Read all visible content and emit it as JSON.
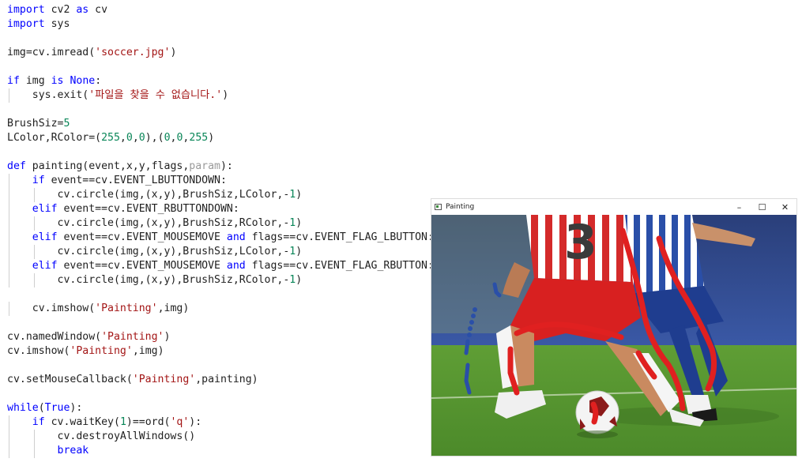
{
  "editor": {
    "lines": [
      [
        {
          "t": "import",
          "c": "kw"
        },
        {
          "t": " cv2 "
        },
        {
          "t": "as",
          "c": "kw"
        },
        {
          "t": " cv"
        }
      ],
      [
        {
          "t": "import",
          "c": "kw"
        },
        {
          "t": " sys"
        }
      ],
      [],
      [
        {
          "t": "img=cv.imread("
        },
        {
          "t": "'soccer.jpg'",
          "c": "str"
        },
        {
          "t": ")"
        }
      ],
      [],
      [
        {
          "t": "if",
          "c": "kw"
        },
        {
          "t": " img "
        },
        {
          "t": "is",
          "c": "kw"
        },
        {
          "t": " "
        },
        {
          "t": "None",
          "c": "kw"
        },
        {
          "t": ":"
        }
      ],
      [
        {
          "t": "    sys.exit("
        },
        {
          "t": "'파일을 찾을 수 없습니다.'",
          "c": "str"
        },
        {
          "t": ")"
        }
      ],
      [],
      [
        {
          "t": "BrushSiz="
        },
        {
          "t": "5",
          "c": "num"
        }
      ],
      [
        {
          "t": "LColor,RColor=("
        },
        {
          "t": "255",
          "c": "num"
        },
        {
          "t": ","
        },
        {
          "t": "0",
          "c": "num"
        },
        {
          "t": ","
        },
        {
          "t": "0",
          "c": "num"
        },
        {
          "t": "),("
        },
        {
          "t": "0",
          "c": "num"
        },
        {
          "t": ","
        },
        {
          "t": "0",
          "c": "num"
        },
        {
          "t": ","
        },
        {
          "t": "255",
          "c": "num"
        },
        {
          "t": ")"
        }
      ],
      [],
      [
        {
          "t": "def",
          "c": "kw"
        },
        {
          "t": " painting(event,x,y,flags,"
        },
        {
          "t": "param",
          "c": "param"
        },
        {
          "t": "):"
        }
      ],
      [
        {
          "t": "    "
        },
        {
          "t": "if",
          "c": "kw"
        },
        {
          "t": " event==cv.EVENT_LBUTTONDOWN:"
        }
      ],
      [
        {
          "t": "        cv.circle(img,(x,y),BrushSiz,LColor,-"
        },
        {
          "t": "1",
          "c": "num"
        },
        {
          "t": ")"
        }
      ],
      [
        {
          "t": "    "
        },
        {
          "t": "elif",
          "c": "kw"
        },
        {
          "t": " event==cv.EVENT_RBUTTONDOWN:"
        }
      ],
      [
        {
          "t": "        cv.circle(img,(x,y),BrushSiz,RColor,-"
        },
        {
          "t": "1",
          "c": "num"
        },
        {
          "t": ")"
        }
      ],
      [
        {
          "t": "    "
        },
        {
          "t": "elif",
          "c": "kw"
        },
        {
          "t": " event==cv.EVENT_MOUSEMOVE "
        },
        {
          "t": "and",
          "c": "kw"
        },
        {
          "t": " flags==cv.EVENT_FLAG_LBUTTON:"
        }
      ],
      [
        {
          "t": "        cv.circle(img,(x,y),BrushSiz,LColor,-"
        },
        {
          "t": "1",
          "c": "num"
        },
        {
          "t": ")"
        }
      ],
      [
        {
          "t": "    "
        },
        {
          "t": "elif",
          "c": "kw"
        },
        {
          "t": " event==cv.EVENT_MOUSEMOVE "
        },
        {
          "t": "and",
          "c": "kw"
        },
        {
          "t": " flags==cv.EVENT_FLAG_RBUTTON:"
        }
      ],
      [
        {
          "t": "        cv.circle(img,(x,y),BrushSiz,RColor,-"
        },
        {
          "t": "1",
          "c": "num"
        },
        {
          "t": ")"
        }
      ],
      [],
      [
        {
          "t": "    cv.imshow("
        },
        {
          "t": "'Painting'",
          "c": "str"
        },
        {
          "t": ",img)"
        }
      ],
      [],
      [
        {
          "t": "cv.namedWindow("
        },
        {
          "t": "'Painting'",
          "c": "str"
        },
        {
          "t": ")"
        }
      ],
      [
        {
          "t": "cv.imshow("
        },
        {
          "t": "'Painting'",
          "c": "str"
        },
        {
          "t": ",img)"
        }
      ],
      [],
      [
        {
          "t": "cv.setMouseCallback("
        },
        {
          "t": "'Painting'",
          "c": "str"
        },
        {
          "t": ",painting)"
        }
      ],
      [],
      [
        {
          "t": "while",
          "c": "kw"
        },
        {
          "t": "("
        },
        {
          "t": "True",
          "c": "kw"
        },
        {
          "t": "):"
        }
      ],
      [
        {
          "t": "    "
        },
        {
          "t": "if",
          "c": "kw"
        },
        {
          "t": " cv.waitKey("
        },
        {
          "t": "1",
          "c": "num"
        },
        {
          "t": ")==ord("
        },
        {
          "t": "'q'",
          "c": "str"
        },
        {
          "t": "):"
        }
      ],
      [
        {
          "t": "        cv.destroyAllWindows()"
        }
      ],
      [
        {
          "t": "        "
        },
        {
          "t": "break",
          "c": "kw"
        }
      ]
    ]
  },
  "window": {
    "title": "Painting",
    "minimize_glyph": "–",
    "maximize_glyph": "☐",
    "close_glyph": "✕",
    "jersey_number": "3"
  },
  "colors": {
    "keyword": "#0000ff",
    "string": "#a31515",
    "number": "#098658",
    "brush_left": "#e02020",
    "brush_right": "#2a4fa8"
  }
}
